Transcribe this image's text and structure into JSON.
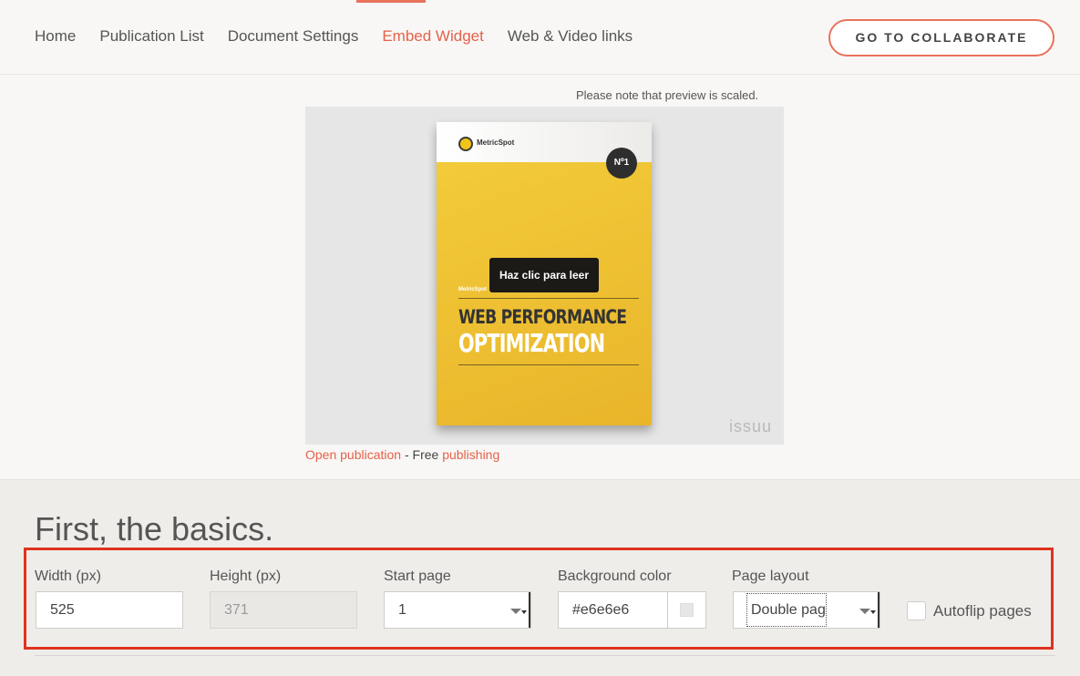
{
  "nav": {
    "items": [
      "Home",
      "Publication List",
      "Document Settings",
      "Embed Widget",
      "Web & Video links"
    ],
    "active": "Embed Widget",
    "collaborate_label": "GO TO COLLABORATE"
  },
  "preview": {
    "note": "Please note that preview is scaled.",
    "cover": {
      "logo": "MetricSpot",
      "badge": "Nº1",
      "small_label": "MetricSpot",
      "title_line1": "WEB PERFORMANCE",
      "title_line2": "OPTIMIZATION"
    },
    "read_button": "Haz clic para leer",
    "watermark": "issuu",
    "open_link": "Open publication",
    "separator": " - Free ",
    "publishing_link": "publishing"
  },
  "basics": {
    "title": "First, the basics.",
    "width": {
      "label": "Width (px)",
      "value": "525"
    },
    "height": {
      "label": "Height (px)",
      "value": "371"
    },
    "start_page": {
      "label": "Start page",
      "value": "1"
    },
    "background_color": {
      "label": "Background color",
      "value": "#e6e6e6",
      "swatch": "#e6e6e6"
    },
    "page_layout": {
      "label": "Page layout",
      "value": "Double page"
    },
    "autoflip": {
      "label": "Autoflip pages",
      "checked": false
    }
  },
  "colors": {
    "accent": "#e5614a",
    "highlight_border": "#e0321e",
    "cover_yellow": "#efc232"
  }
}
